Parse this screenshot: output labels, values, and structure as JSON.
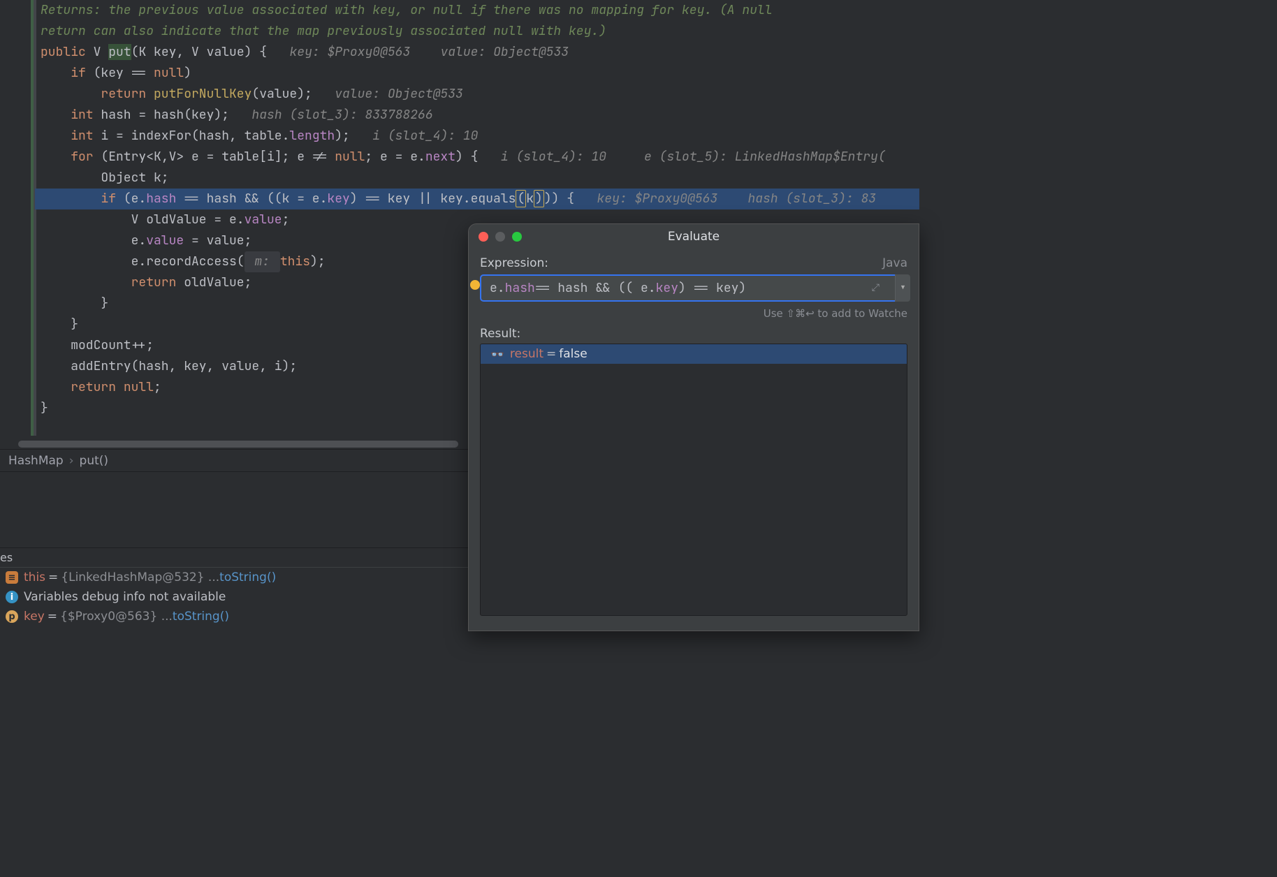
{
  "editor": {
    "javadoc_line1": "Returns: the previous value associated with key, or null if there was no mapping for key. (A null",
    "javadoc_line2": "return can also indicate that the map previously associated null with key.)",
    "sig_public": "public",
    "sig_V": "V",
    "sig_put": "put",
    "sig_params": "(K key, V value) {",
    "sig_inlay": "key: $Proxy0@563    value: Object@533",
    "l2": "    if (key == null)",
    "l3_kw": "        return ",
    "l3_m": "putForNullKey",
    "l3_rest": "(value);",
    "l3_inlay": "value: Object@533",
    "l4_pre": "    int hash = hash(key);",
    "l4_inlay": "hash (slot_3): 833788266",
    "l5_pre": "    int i = indexFor(hash, table.length);",
    "l5_inlay": "i (slot_4): 10",
    "l6_pre": "    for (Entry<K,V> e = table[i]; e != null; e = e.next) {",
    "l6_inlay": "i (slot_4): 10     e (slot_5): LinkedHashMap$Entry(",
    "l7": "        Object k;",
    "l8_a": "        if (e.hash == hash && ((k = e.key) == key || key.equals",
    "l8_b": "(",
    "l8_c": "k",
    "l8_d": ")",
    "l8_e": ")) {",
    "l8_inlay": "key: $Proxy0@563    hash (slot_3): 83",
    "l9": "            V oldValue = e.value;",
    "l10": "            e.value = value;",
    "l11_a": "            e.recordAccess(",
    "l11_hint": " m: ",
    "l11_b": "this);",
    "l12_kw": "            return ",
    "l12_v": "oldValue;",
    "l13": "        }",
    "l14": "    }",
    "l15": "",
    "l16": "    modCount++;",
    "l17": "    addEntry(hash, key, value, i);",
    "l18_kw": "    return ",
    "l18_v": "null;",
    "l19": "}"
  },
  "breadcrumb": {
    "cls": "HashMap",
    "method": "put()"
  },
  "variables": {
    "tab": "es",
    "this_name": "this",
    "this_val": "{LinkedHashMap@532}  ... ",
    "this_link": "toString()",
    "info": "Variables debug info not available",
    "key_name": "key",
    "key_val": "{$Proxy0@563}  ... ",
    "key_link": "toString()"
  },
  "evaluate": {
    "title": "Evaluate",
    "expr_label": "Expression:",
    "lang": "Java",
    "expression_pre": "e.",
    "expression_hash": "hash",
    "expression_mid": " == hash && (( e.",
    "expression_key": "key",
    "expression_post": ") == key)",
    "hint": "Use ⇧⌘↩ to add to Watche",
    "result_label": "Result:",
    "result_name": "result",
    "result_val": "false"
  }
}
